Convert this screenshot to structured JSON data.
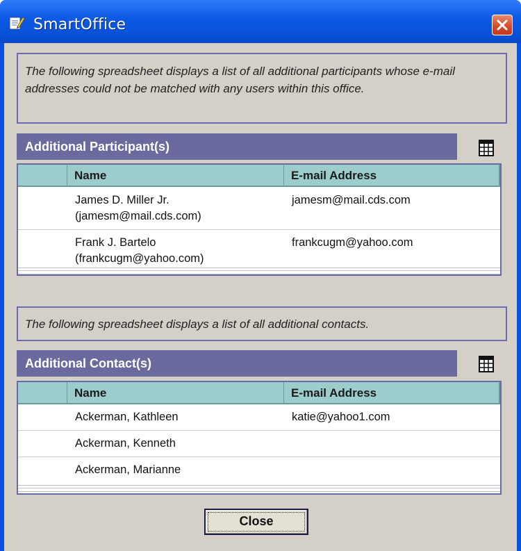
{
  "window": {
    "title": "SmartOffice",
    "title_icon": "document-edit-icon",
    "close_icon": "close-icon"
  },
  "participants_section": {
    "description": "The following spreadsheet displays a list of all additional participants whose e-mail addresses could not be matched with any users within this office.",
    "header": "Additional Participant(s)",
    "grid_icon": "spreadsheet-grid-icon",
    "columns": [
      "Name",
      "E-mail Address"
    ],
    "rows": [
      {
        "name_line1": "James D. Miller Jr.",
        "name_line2": "(jamesm@mail.cds.com)",
        "email": "jamesm@mail.cds.com"
      },
      {
        "name_line1": "Frank J. Bartelo",
        "name_line2": "(frankcugm@yahoo.com)",
        "email": "frankcugm@yahoo.com"
      }
    ]
  },
  "contacts_section": {
    "description": "The following spreadsheet displays a list of all additional contacts.",
    "header": "Additional Contact(s)",
    "grid_icon": "spreadsheet-grid-icon",
    "columns": [
      "Name",
      "E-mail Address"
    ],
    "rows": [
      {
        "name": "Ackerman, Kathleen",
        "email": "katie@yahoo1.com"
      },
      {
        "name": "Ackerman, Kenneth",
        "email": ""
      },
      {
        "name": "Ackerman, Marianne",
        "email": ""
      }
    ]
  },
  "footer": {
    "close_label": "Close"
  },
  "colors": {
    "title_bar": "#0a53e0",
    "section_header": "#6a6a9e",
    "table_header": "#9ccccc",
    "dialog_background": "#d4d0c8"
  }
}
